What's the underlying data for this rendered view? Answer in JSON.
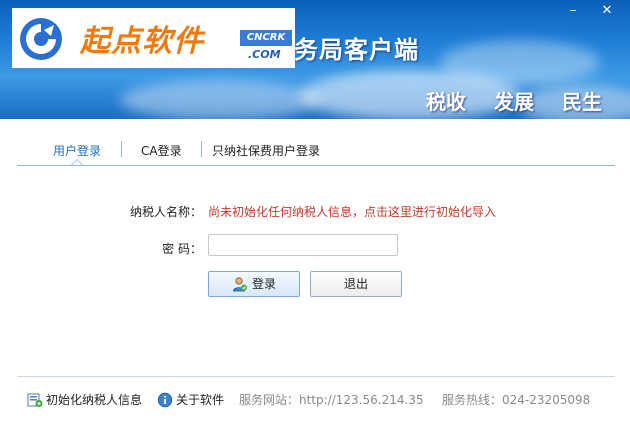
{
  "window": {
    "logo": {
      "name": "起点软件",
      "badge": "CNCRK",
      "domain": ".COM"
    },
    "title": "务局客户端",
    "slogans": [
      "税收",
      "发展",
      "民生"
    ],
    "controls": {
      "minimize": "–",
      "close": "✕"
    }
  },
  "tabs": [
    {
      "label": "用户登录",
      "active": true
    },
    {
      "label": "CA登录",
      "active": false
    },
    {
      "label": "只纳社保费用户登录",
      "active": false
    }
  ],
  "form": {
    "taxpayer_label": "纳税人名称：",
    "taxpayer_value": "尚未初始化任何纳税人信息，点击这里进行初始化导入",
    "password_label": "密  码：",
    "password_value": "",
    "login_label": "登录",
    "exit_label": "退出"
  },
  "footer": {
    "init_label": "初始化纳税人信息",
    "about_label": "关于软件",
    "service_site": "服务网站：http://123.56.214.35",
    "service_hotline": "服务热线：024-23205098"
  },
  "colors": {
    "banner_blue": "#1f7fd6",
    "tab_active": "#1e6fc4",
    "warning_text": "#c0392b",
    "logo_orange": "#f07a10"
  }
}
